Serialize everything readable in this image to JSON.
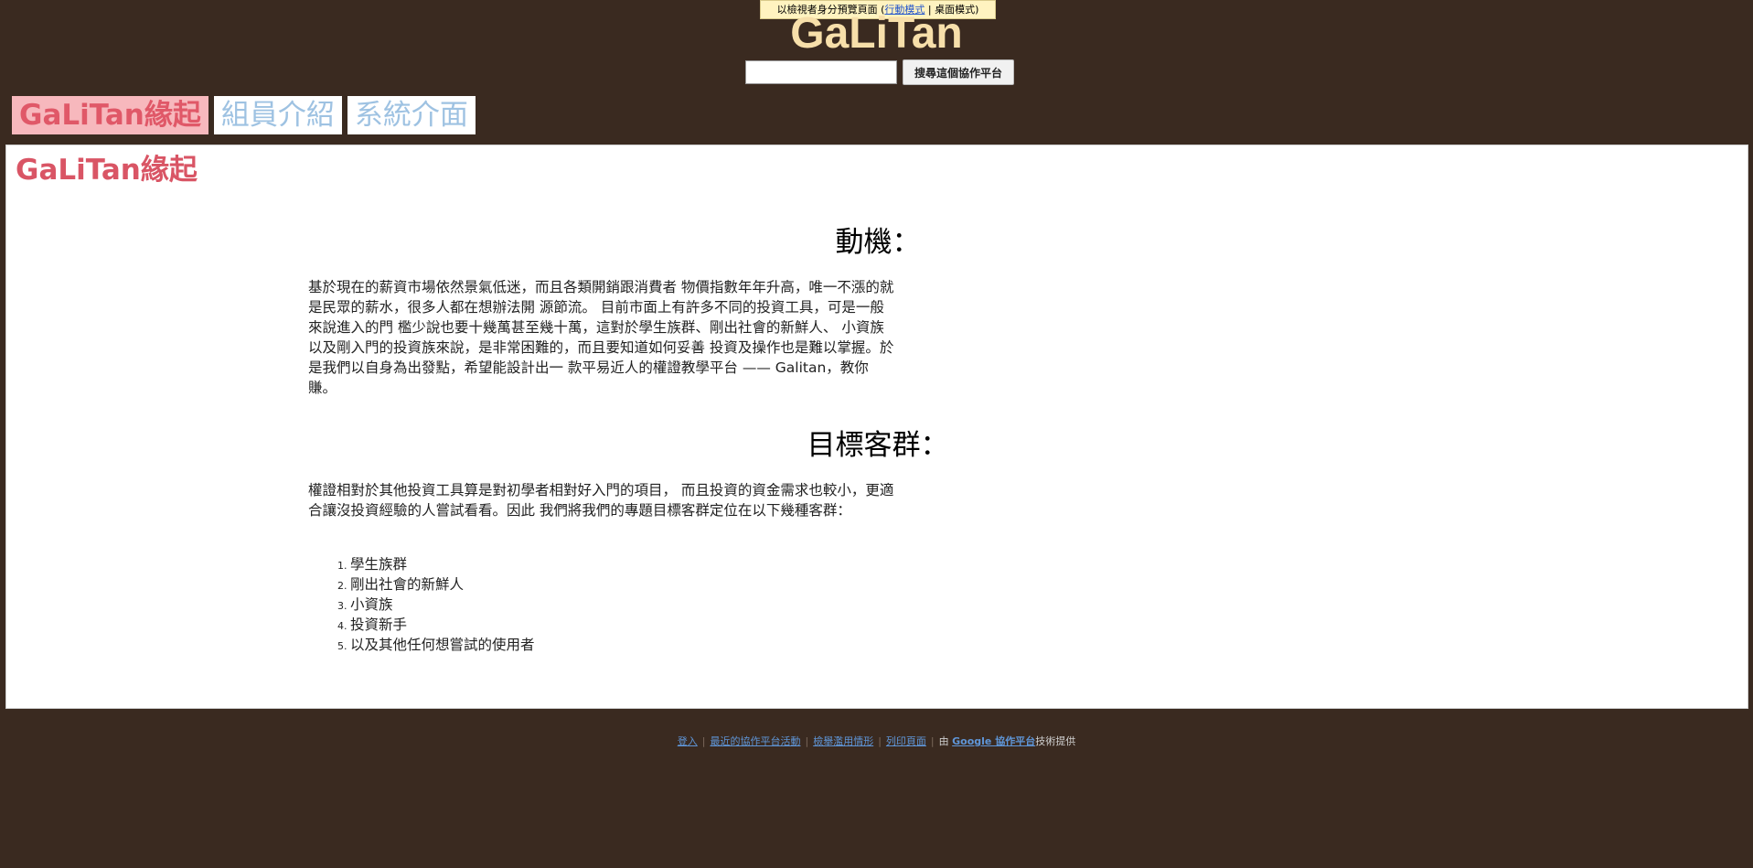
{
  "preview_bar": {
    "text_before": "以檢視者身分預覽頁面 (",
    "mobile_mode": "行動模式",
    "separator": " | ",
    "desktop_mode": "桌面模式",
    "text_after": ")"
  },
  "site": {
    "title": "GaLiTan"
  },
  "search": {
    "value": "",
    "button_label": "搜尋這個協作平台"
  },
  "nav": {
    "tabs": [
      {
        "label": "GaLiTan緣起"
      },
      {
        "label": "組員介紹"
      },
      {
        "label": "系統介面"
      }
    ]
  },
  "page": {
    "heading": "GaLiTan緣起",
    "sections": [
      {
        "heading": "動機：",
        "body": "基於現在的薪資市場依然景氣低迷，而且各類開銷跟消費者 物價指數年年升高，唯一不漲的就是民眾的薪水，很多人都在想辦法開 源節流。 目前市面上有許多不同的投資工具，可是一般來說進入的門 檻少說也要十幾萬甚至幾十萬，這對於學生族群、剛出社會的新鮮人、 小資族以及剛入門的投資族來說，是非常困難的，而且要知道如何妥善 投資及操作也是難以掌握。於是我們以自身為出發點，希望能設計出一 款平易近人的權證教學平台 —— Galitan，教你賺。"
      },
      {
        "heading": "目標客群：",
        "body": "權證相對於其他投資工具算是對初學者相對好入門的項目， 而且投資的資金需求也較小，更適合讓沒投資經驗的人嘗試看看。因此 我們將我們的專題目標客群定位在以下幾種客群：",
        "items": [
          "學生族群",
          "剛出社會的新鮮人",
          "小資族",
          "投資新手",
          "以及其他任何想嘗試的使用者"
        ]
      }
    ]
  },
  "footer": {
    "links": [
      "登入",
      "最近的協作平台活動",
      "檢舉濫用情形",
      "列印頁面"
    ],
    "powered_prefix": "由",
    "powered_link": "Google 協作平台",
    "powered_suffix": "技術提供"
  }
}
